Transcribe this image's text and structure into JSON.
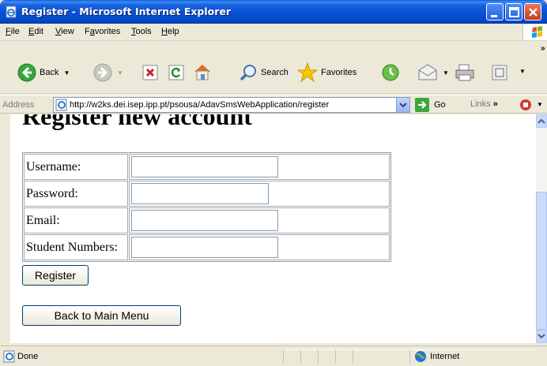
{
  "window": {
    "title": "Register - Microsoft Internet Explorer",
    "app_icon": "ie-page-icon",
    "controls": [
      "minimize-icon",
      "maximize-icon",
      "close-icon"
    ]
  },
  "menu": {
    "items": [
      {
        "key": "F",
        "rest": "ile"
      },
      {
        "key": "E",
        "rest": "dit"
      },
      {
        "key": "V",
        "rest": "iew"
      },
      {
        "key": "",
        "pre": "F",
        "mid": "a",
        "rest": "vorites"
      },
      {
        "key": "T",
        "rest": "ools"
      },
      {
        "key": "H",
        "rest": "elp"
      }
    ]
  },
  "toolbar": {
    "back_label": "Back",
    "search_label": "Search",
    "favorites_label": "Favorites"
  },
  "address": {
    "label": "Address",
    "url": "http://w2ks.dei.isep.ipp.pt/psousa/AdavSmsWebApplication/register",
    "go_label": "Go",
    "links_label": "Links"
  },
  "page": {
    "heading": "Register new account",
    "fields": [
      {
        "label": "Username:",
        "value": ""
      },
      {
        "label": "Password:",
        "value": ""
      },
      {
        "label": "Email:",
        "value": ""
      },
      {
        "label": "Student Numbers:",
        "value": ""
      }
    ],
    "register_button": "Register",
    "back_button": "Back to Main Menu"
  },
  "status": {
    "text": "Done",
    "zone": "Internet"
  },
  "colors": {
    "titlebar": "#0653d6",
    "chrome": "#ece9d8",
    "input_border": "#7f9db9"
  }
}
